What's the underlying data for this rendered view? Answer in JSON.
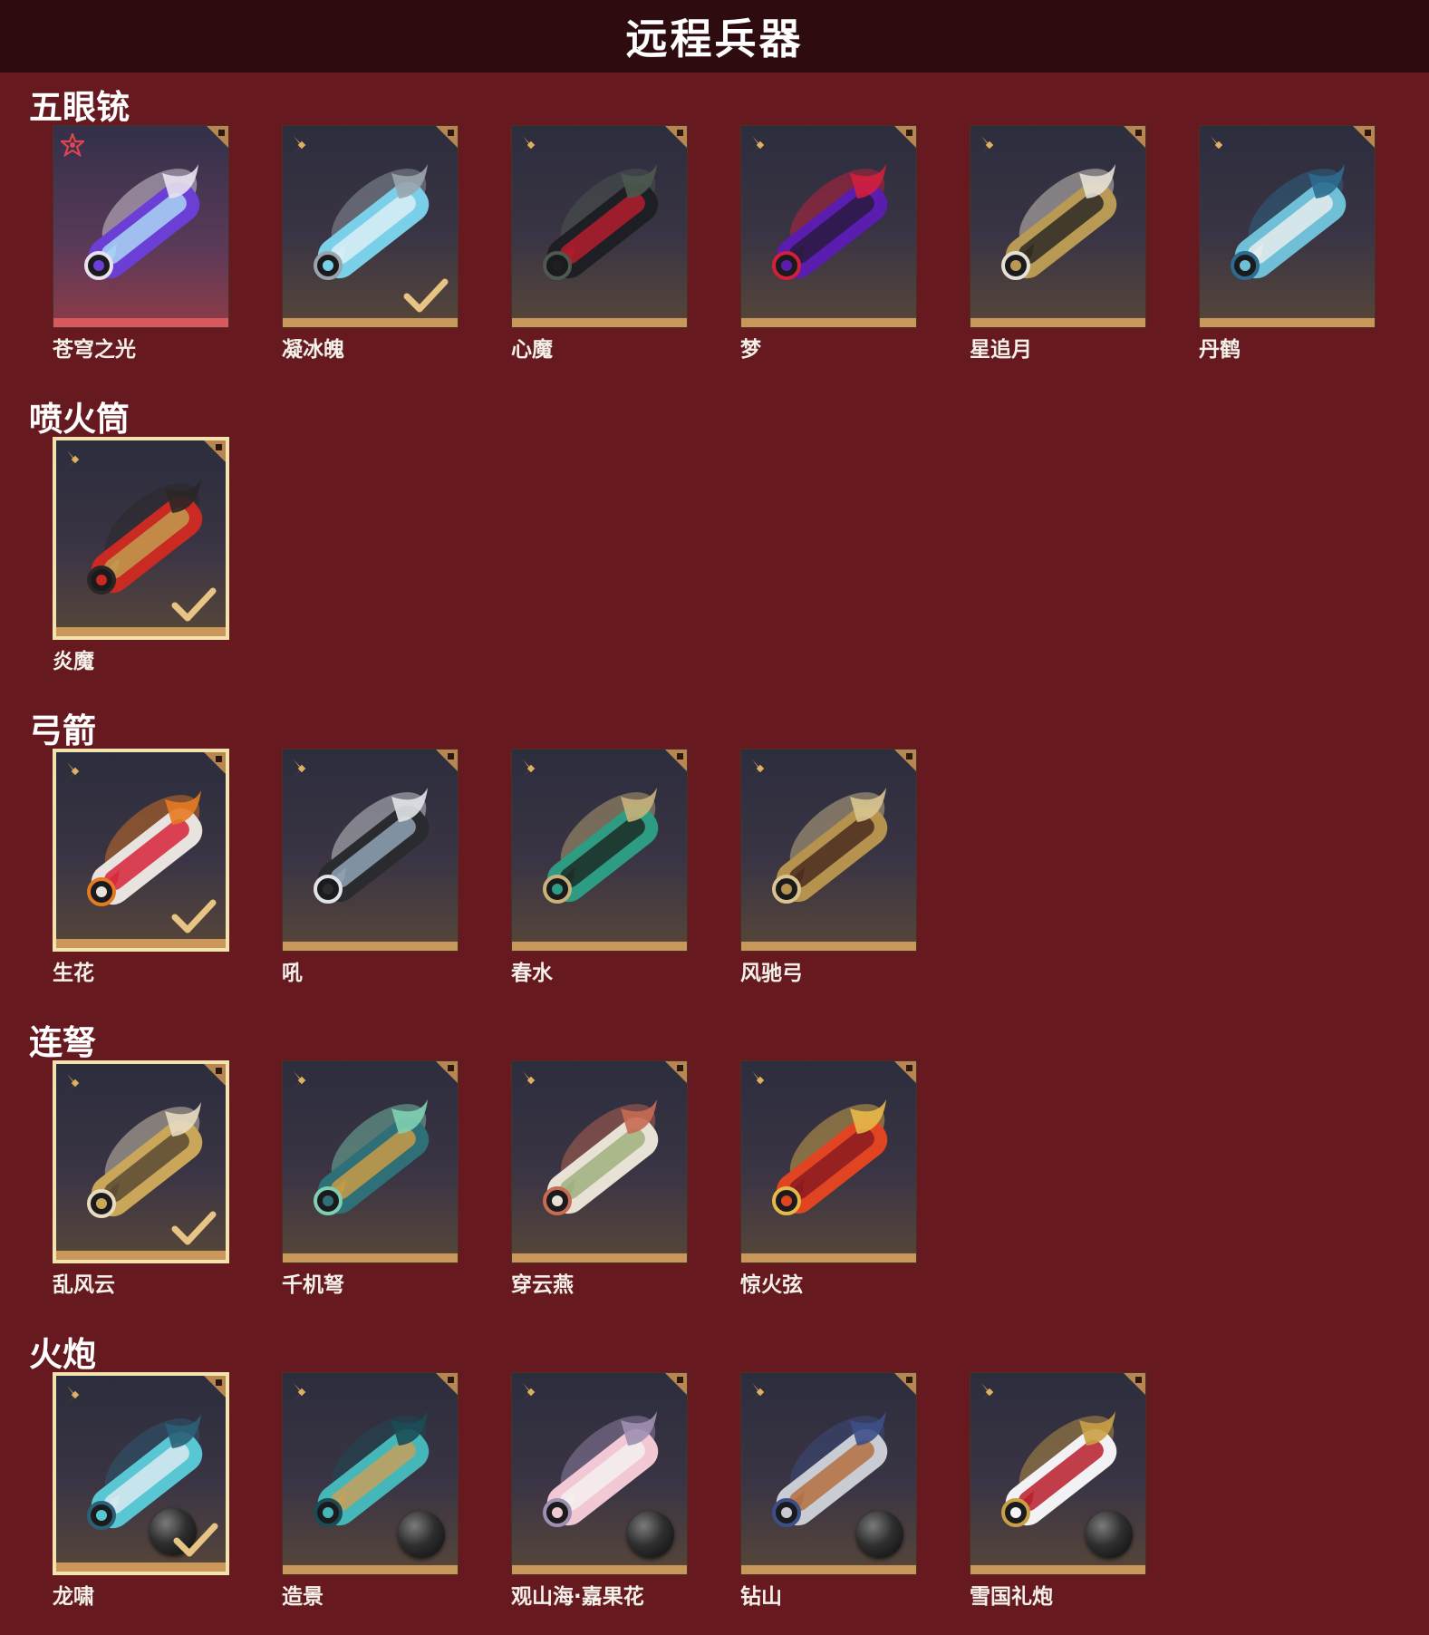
{
  "page": {
    "title": "远程兵器"
  },
  "sections": [
    {
      "title": "五眼铳",
      "items": [
        {
          "label": "苍穹之光",
          "rare": true,
          "equipped": false,
          "checked": false,
          "ammo": false,
          "colors": [
            "#6b3fd6",
            "#a9d6f5",
            "#e9e2ee"
          ]
        },
        {
          "label": "凝冰魄",
          "rare": false,
          "equipped": false,
          "checked": true,
          "ammo": false,
          "colors": [
            "#7ad0e8",
            "#d9eef5",
            "#9aa4ad"
          ]
        },
        {
          "label": "心魔",
          "rare": false,
          "equipped": false,
          "checked": false,
          "ammo": false,
          "colors": [
            "#1d1f24",
            "#b31d2d",
            "#4d5a4f"
          ]
        },
        {
          "label": "梦",
          "rare": false,
          "equipped": false,
          "checked": false,
          "ammo": false,
          "colors": [
            "#5b1db0",
            "#2a1a3f",
            "#d21f3b"
          ]
        },
        {
          "label": "星追月",
          "rare": false,
          "equipped": false,
          "checked": false,
          "ammo": false,
          "colors": [
            "#b89a55",
            "#2d2a24",
            "#e6e1d5"
          ]
        },
        {
          "label": "丹鹤",
          "rare": false,
          "equipped": false,
          "checked": false,
          "ammo": false,
          "colors": [
            "#6fc0d6",
            "#e8ecef",
            "#2d6b8f"
          ]
        }
      ]
    },
    {
      "title": "喷火筒",
      "items": [
        {
          "label": "炎魔",
          "rare": false,
          "equipped": true,
          "checked": true,
          "ammo": false,
          "colors": [
            "#c92a22",
            "#c29a4d",
            "#2b2626"
          ]
        }
      ]
    },
    {
      "title": "弓箭",
      "items": [
        {
          "label": "生花",
          "rare": false,
          "equipped": true,
          "checked": true,
          "ammo": false,
          "colors": [
            "#e8e3de",
            "#d6243a",
            "#e57a22"
          ]
        },
        {
          "label": "吼",
          "rare": false,
          "equipped": false,
          "checked": false,
          "ammo": false,
          "colors": [
            "#2a2b2f",
            "#8fa4b6",
            "#e0e4e8"
          ]
        },
        {
          "label": "春水",
          "rare": false,
          "equipped": false,
          "checked": false,
          "ammo": false,
          "colors": [
            "#2d9c83",
            "#1d2b27",
            "#c8b27a"
          ]
        },
        {
          "label": "风驰弓",
          "rare": false,
          "equipped": false,
          "checked": false,
          "ammo": false,
          "colors": [
            "#b5924d",
            "#4a2c20",
            "#d9c590"
          ]
        }
      ]
    },
    {
      "title": "连弩",
      "items": [
        {
          "label": "乱风云",
          "rare": false,
          "equipped": true,
          "checked": true,
          "ammo": false,
          "colors": [
            "#c9a65a",
            "#5a4a33",
            "#e7dcc0"
          ]
        },
        {
          "label": "千机弩",
          "rare": false,
          "equipped": false,
          "checked": false,
          "ammo": false,
          "colors": [
            "#2f6f77",
            "#c89b47",
            "#7fd0b3"
          ]
        },
        {
          "label": "穿云燕",
          "rare": false,
          "equipped": false,
          "checked": false,
          "ammo": false,
          "colors": [
            "#e8e2d6",
            "#9fb07e",
            "#c86b52"
          ]
        },
        {
          "label": "惊火弦",
          "rare": false,
          "equipped": false,
          "checked": false,
          "ammo": false,
          "colors": [
            "#e14420",
            "#8a1a22",
            "#e6b94a"
          ]
        }
      ]
    },
    {
      "title": "火炮",
      "items": [
        {
          "label": "龙啸",
          "rare": false,
          "equipped": true,
          "checked": true,
          "ammo": true,
          "colors": [
            "#58c6d3",
            "#d8e9ee",
            "#2c5f78"
          ]
        },
        {
          "label": "造景",
          "rare": false,
          "equipped": false,
          "checked": false,
          "ammo": true,
          "colors": [
            "#46b7b8",
            "#c4a05b",
            "#1b4c56"
          ]
        },
        {
          "label": "观山海·嘉果花",
          "rare": false,
          "equipped": false,
          "checked": false,
          "ammo": true,
          "colors": [
            "#f2c8d4",
            "#f4f0ee",
            "#9f8fb3"
          ]
        },
        {
          "label": "钻山",
          "rare": false,
          "equipped": false,
          "checked": false,
          "ammo": true,
          "colors": [
            "#c9ccd2",
            "#b46f42",
            "#3d4f87"
          ]
        },
        {
          "label": "雪国礼炮",
          "rare": false,
          "equipped": false,
          "checked": false,
          "ammo": true,
          "colors": [
            "#f2f2f4",
            "#b81d2a",
            "#c9a045"
          ]
        }
      ]
    }
  ]
}
